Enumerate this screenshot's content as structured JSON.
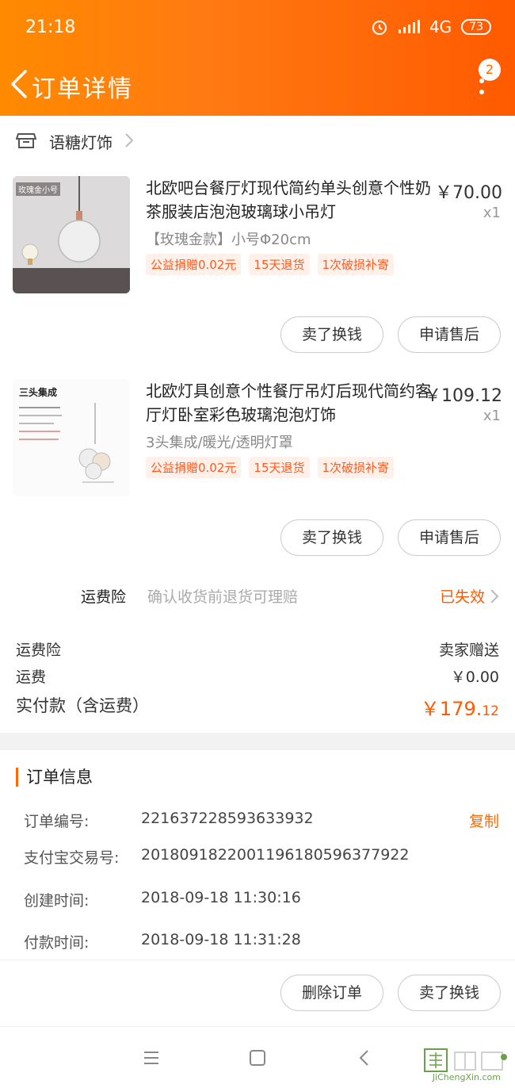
{
  "status": {
    "time": "21:18",
    "network": "4G",
    "battery": "73"
  },
  "nav": {
    "title": "订单详情",
    "badge_count": "2"
  },
  "store": {
    "name": "语糖灯饰"
  },
  "products": [
    {
      "thumb_label": "玫瑰金小号",
      "title": "北欧吧台餐厅灯现代简约单头创意个性奶茶服装店泡泡玻璃球小吊灯",
      "price": "￥70.00",
      "qty": "x1",
      "spec": "【玫瑰金款】小号Φ20cm",
      "tags": [
        "公益捐赠0.02元",
        "15天退货",
        "1次破损补寄"
      ],
      "btn_sell": "卖了换钱",
      "btn_after_sale": "申请售后"
    },
    {
      "thumb_label": "三头集成",
      "title": "北欧灯具创意个性餐厅吊灯后现代简约客厅灯卧室彩色玻璃泡泡灯饰",
      "price": "￥109.12",
      "qty": "x1",
      "spec": "3头集成/暖光/透明灯罩",
      "tags": [
        "公益捐赠0.02元",
        "15天退货",
        "1次破损补寄"
      ],
      "btn_sell": "卖了换钱",
      "btn_after_sale": "申请售后"
    }
  ],
  "insurance": {
    "label": "运费险",
    "desc": "确认收货前退货可理赔",
    "status": "已失效"
  },
  "summary": {
    "ins_label": "运费险",
    "ins_value": "卖家赠送",
    "ship_label": "运费",
    "ship_value": "￥0.00",
    "total_label": "实付款（含运费）",
    "total_main": "￥179.",
    "total_cents": "12"
  },
  "order_info": {
    "title": "订单信息",
    "order_no_label": "订单编号:",
    "order_no": "221637228593633932",
    "copy": "复制",
    "alipay_label": "支付宝交易号:",
    "alipay_no": "2018091822001196180596377922",
    "created_label": "创建时间:",
    "created": "2018-09-18 11:30:16",
    "paid_label": "付款时间:",
    "paid": "2018-09-18 11:31:28"
  },
  "actions": {
    "delete": "删除订单",
    "sell": "卖了换钱"
  },
  "watermark": {
    "text": "JiChengXin.com"
  },
  "colors": {
    "accent": "#ff6a00",
    "tag_bg": "#fff1ea"
  }
}
